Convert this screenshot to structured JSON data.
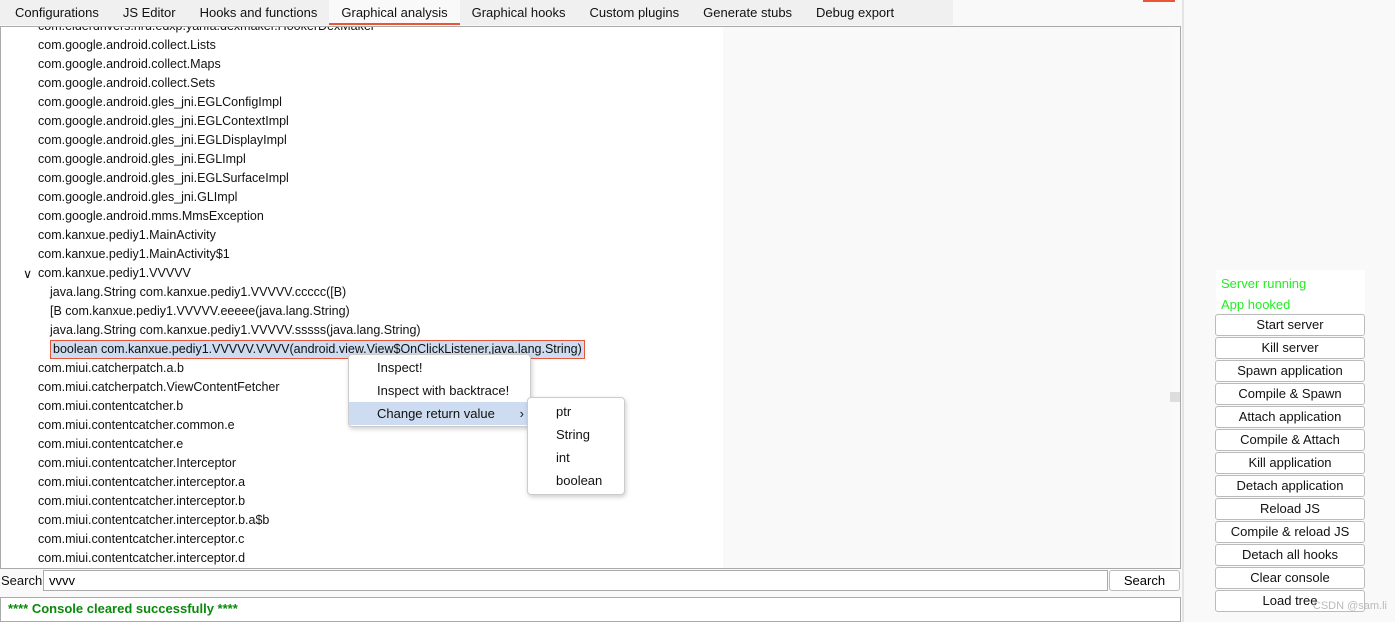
{
  "tabs": [
    "Configurations",
    "JS Editor",
    "Hooks and functions",
    "Graphical analysis",
    "Graphical hooks",
    "Custom plugins",
    "Generate stubs",
    "Debug export"
  ],
  "active_tab": "Graphical analysis",
  "tree": [
    {
      "text": "com.elderdrivers.riru.edxp.yahfa.dexmaker.HookerDexMaker",
      "level": 0
    },
    {
      "text": "com.google.android.collect.Lists",
      "level": 0
    },
    {
      "text": "com.google.android.collect.Maps",
      "level": 0
    },
    {
      "text": "com.google.android.collect.Sets",
      "level": 0
    },
    {
      "text": "com.google.android.gles_jni.EGLConfigImpl",
      "level": 0
    },
    {
      "text": "com.google.android.gles_jni.EGLContextImpl",
      "level": 0
    },
    {
      "text": "com.google.android.gles_jni.EGLDisplayImpl",
      "level": 0
    },
    {
      "text": "com.google.android.gles_jni.EGLImpl",
      "level": 0
    },
    {
      "text": "com.google.android.gles_jni.EGLSurfaceImpl",
      "level": 0
    },
    {
      "text": "com.google.android.gles_jni.GLImpl",
      "level": 0
    },
    {
      "text": "com.google.android.mms.MmsException",
      "level": 0
    },
    {
      "text": "com.kanxue.pediy1.MainActivity",
      "level": 0
    },
    {
      "text": "com.kanxue.pediy1.MainActivity$1",
      "level": 0
    },
    {
      "text": "com.kanxue.pediy1.VVVVV",
      "level": 0,
      "expanded": true
    },
    {
      "text": "java.lang.String com.kanxue.pediy1.VVVVV.ccccc([B)",
      "level": 1
    },
    {
      "text": "[B com.kanxue.pediy1.VVVVV.eeeee(java.lang.String)",
      "level": 1
    },
    {
      "text": "java.lang.String com.kanxue.pediy1.VVVVV.sssss(java.lang.String)",
      "level": 1
    },
    {
      "text": "boolean com.kanxue.pediy1.VVVVV.VVVV(android.view.View$OnClickListener,java.lang.String)",
      "level": 1,
      "selected": true
    },
    {
      "text": "com.miui.catcherpatch.a.b",
      "level": 0
    },
    {
      "text": "com.miui.catcherpatch.ViewContentFetcher",
      "level": 0
    },
    {
      "text": "com.miui.contentcatcher.b",
      "level": 0
    },
    {
      "text": "com.miui.contentcatcher.common.e",
      "level": 0
    },
    {
      "text": "com.miui.contentcatcher.e",
      "level": 0
    },
    {
      "text": "com.miui.contentcatcher.Interceptor",
      "level": 0
    },
    {
      "text": "com.miui.contentcatcher.interceptor.a",
      "level": 0
    },
    {
      "text": "com.miui.contentcatcher.interceptor.b",
      "level": 0
    },
    {
      "text": "com.miui.contentcatcher.interceptor.b.a$b",
      "level": 0
    },
    {
      "text": "com.miui.contentcatcher.interceptor.c",
      "level": 0
    },
    {
      "text": "com.miui.contentcatcher.interceptor.d",
      "level": 0
    }
  ],
  "context_menu": {
    "items": [
      "Inspect!",
      "Inspect with backtrace!",
      "Change return value"
    ],
    "submenu": [
      "ptr",
      "String",
      "int",
      "boolean"
    ]
  },
  "search": {
    "label": "Search:",
    "value": "vvvv",
    "button": "Search"
  },
  "console": {
    "text": "**** Console cleared successfully ****"
  },
  "status": {
    "server": "Server running",
    "app": "App hooked",
    "color": "#22ee22"
  },
  "buttons": [
    "Start server",
    "Kill server",
    "Spawn application",
    "Compile & Spawn",
    "Attach application",
    "Compile & Attach",
    "Kill application",
    "Detach application",
    "Reload JS",
    "Compile & reload JS",
    "Detach all hooks",
    "Clear console",
    "Load tree"
  ],
  "watermark": "CSDN @sam.li"
}
